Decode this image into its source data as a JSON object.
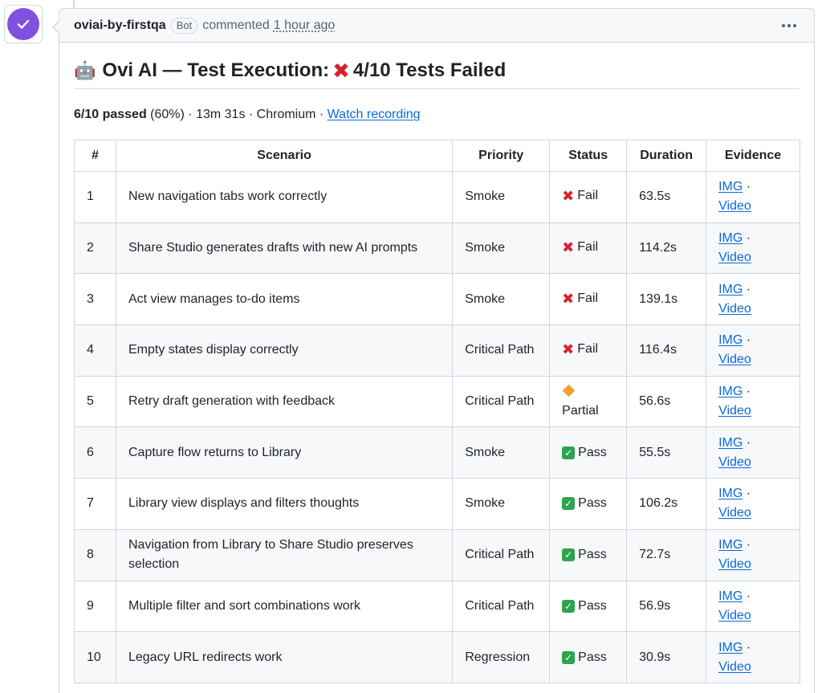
{
  "comment": {
    "author": "oviai-by-firstqa",
    "badge": "Bot",
    "action": "commented",
    "time": "1 hour ago"
  },
  "report": {
    "robot_emoji": "🤖",
    "title_prefix": "Ovi AI — Test Execution:",
    "title_status_icon": "❌",
    "title_suffix": "4/10 Tests Failed",
    "summary_bold": "6/10 passed",
    "summary_rest": " (60%) · 13m 31s · Chromium · ",
    "recording_link": "Watch recording"
  },
  "table": {
    "headers": [
      "#",
      "Scenario",
      "Priority",
      "Status",
      "Duration",
      "Evidence"
    ],
    "evidence_img": "IMG",
    "evidence_sep": " ·",
    "evidence_video": "Video",
    "rows": [
      {
        "num": "1",
        "scenario": "New navigation tabs work correctly",
        "priority": "Smoke",
        "status": "Fail",
        "duration": "63.5s"
      },
      {
        "num": "2",
        "scenario": "Share Studio generates drafts with new AI prompts",
        "priority": "Smoke",
        "status": "Fail",
        "duration": "114.2s"
      },
      {
        "num": "3",
        "scenario": "Act view manages to-do items",
        "priority": "Smoke",
        "status": "Fail",
        "duration": "139.1s"
      },
      {
        "num": "4",
        "scenario": "Empty states display correctly",
        "priority": "Critical Path",
        "status": "Fail",
        "duration": "116.4s"
      },
      {
        "num": "5",
        "scenario": "Retry draft generation with feedback",
        "priority": "Critical Path",
        "status": "Partial",
        "duration": "56.6s"
      },
      {
        "num": "6",
        "scenario": "Capture flow returns to Library",
        "priority": "Smoke",
        "status": "Pass",
        "duration": "55.5s"
      },
      {
        "num": "7",
        "scenario": "Library view displays and filters thoughts",
        "priority": "Smoke",
        "status": "Pass",
        "duration": "106.2s"
      },
      {
        "num": "8",
        "scenario": "Navigation from Library to Share Studio preserves selection",
        "priority": "Critical Path",
        "status": "Pass",
        "duration": "72.7s"
      },
      {
        "num": "9",
        "scenario": "Multiple filter and sort combinations work",
        "priority": "Critical Path",
        "status": "Pass",
        "duration": "56.9s"
      },
      {
        "num": "10",
        "scenario": "Legacy URL redirects work",
        "priority": "Regression",
        "status": "Pass",
        "duration": "30.9s"
      }
    ]
  },
  "icons": {
    "avatar": "check-icon",
    "menu": "kebab-menu-icon",
    "fail": "cross-mark-icon",
    "pass": "check-mark-icon",
    "partial": "orange-diamond-icon"
  },
  "colors": {
    "avatar_bg": "#8250df",
    "link": "#0969da",
    "fail": "#d1242f",
    "pass": "#2da44e",
    "partial": "#f0a030"
  }
}
